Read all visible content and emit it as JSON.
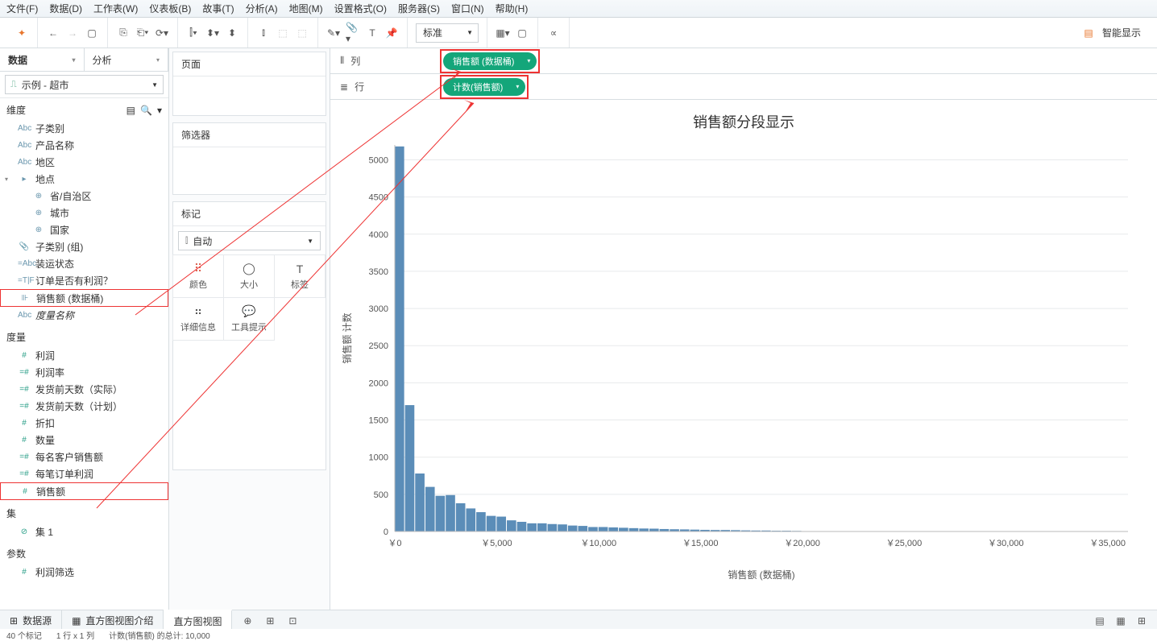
{
  "menus": [
    "文件(F)",
    "数据(D)",
    "工作表(W)",
    "仪表板(B)",
    "故事(T)",
    "分析(A)",
    "地图(M)",
    "设置格式(O)",
    "服务器(S)",
    "窗口(N)",
    "帮助(H)"
  ],
  "toolbar": {
    "std": "标准",
    "showme": "智能显示"
  },
  "left": {
    "tab_data": "数据",
    "tab_analysis": "分析",
    "datasource": "示例 - 超市",
    "sec_dim": "维度",
    "dims": [
      {
        "icn": "Abc",
        "lbl": "子类别"
      },
      {
        "icn": "Abc",
        "lbl": "产品名称"
      },
      {
        "icn": "Abc",
        "lbl": "地区"
      },
      {
        "icn": "▸",
        "lbl": "地点",
        "pre": "▾ 📑"
      },
      {
        "icn": "⊕",
        "lbl": "省/自治区",
        "sub": true
      },
      {
        "icn": "⊕",
        "lbl": "城市",
        "sub": true
      },
      {
        "icn": "⊕",
        "lbl": "国家",
        "sub": true
      },
      {
        "icn": "📎",
        "lbl": "子类别 (组)"
      },
      {
        "icn": "=Abc",
        "lbl": "装运状态"
      },
      {
        "icn": "=T|F",
        "lbl": "订单是否有利润？"
      },
      {
        "icn": "⊪",
        "lbl": "销售额 (数据桶)",
        "red": true
      },
      {
        "icn": "Abc",
        "lbl": "度量名称",
        "ital": true
      }
    ],
    "sec_mea": "度量",
    "meas": [
      {
        "icn": "#",
        "lbl": "利润"
      },
      {
        "icn": "=#",
        "lbl": "利润率"
      },
      {
        "icn": "=#",
        "lbl": "发货前天数（实际）"
      },
      {
        "icn": "=#",
        "lbl": "发货前天数（计划）"
      },
      {
        "icn": "#",
        "lbl": "折扣"
      },
      {
        "icn": "#",
        "lbl": "数量"
      },
      {
        "icn": "=#",
        "lbl": "每名客户销售额"
      },
      {
        "icn": "=#",
        "lbl": "每笔订单利润"
      },
      {
        "icn": "#",
        "lbl": "销售额",
        "red": true
      }
    ],
    "sec_set": "集",
    "sets": [
      {
        "icn": "⊘",
        "lbl": "集 1"
      }
    ],
    "sec_param": "参数",
    "params": [
      {
        "icn": "#",
        "lbl": "利润筛选"
      }
    ]
  },
  "mid": {
    "pages": "页面",
    "filters": "筛选器",
    "marks": "标记",
    "mark_type": "自动",
    "cells": [
      "颜色",
      "大小",
      "标签",
      "详细信息",
      "工具提示"
    ],
    "cell_icons": [
      "⠿",
      "◯",
      "T",
      "⠶",
      "💬"
    ]
  },
  "shelves": {
    "cols_lbl": "列",
    "cols_pill": "销售额 (数据桶)",
    "rows_lbl": "行",
    "rows_pill": "计数(销售额)"
  },
  "chart_data": {
    "type": "bar",
    "title": "销售额分段显示",
    "ylabel": "销售额 计数",
    "xlabel": "销售额 (数据桶)",
    "y_ticks": [
      0,
      500,
      1000,
      1500,
      2000,
      2500,
      3000,
      3500,
      4000,
      4500,
      5000
    ],
    "x_ticks": [
      "￥0",
      "￥5,000",
      "￥10,000",
      "￥15,000",
      "￥20,000",
      "￥25,000",
      "￥30,000",
      "￥35,000"
    ],
    "x_max": 36000,
    "ylim": [
      0,
      5200
    ],
    "values": [
      5180,
      1700,
      780,
      600,
      480,
      490,
      380,
      310,
      260,
      210,
      200,
      150,
      130,
      110,
      110,
      100,
      95,
      80,
      75,
      60,
      60,
      55,
      50,
      45,
      40,
      38,
      33,
      30,
      28,
      25,
      22,
      20,
      20,
      18,
      15,
      13,
      13,
      10,
      10,
      8
    ],
    "bin_width": 500
  },
  "bottom": {
    "datasource": "数据源",
    "tabs": [
      "直方图视图介绍",
      "直方图视图"
    ],
    "active": 1
  },
  "status": {
    "marks": "40 个标记",
    "dims": "1 行 x 1 列",
    "total": "计数(销售额) 的总计: 10,000"
  }
}
